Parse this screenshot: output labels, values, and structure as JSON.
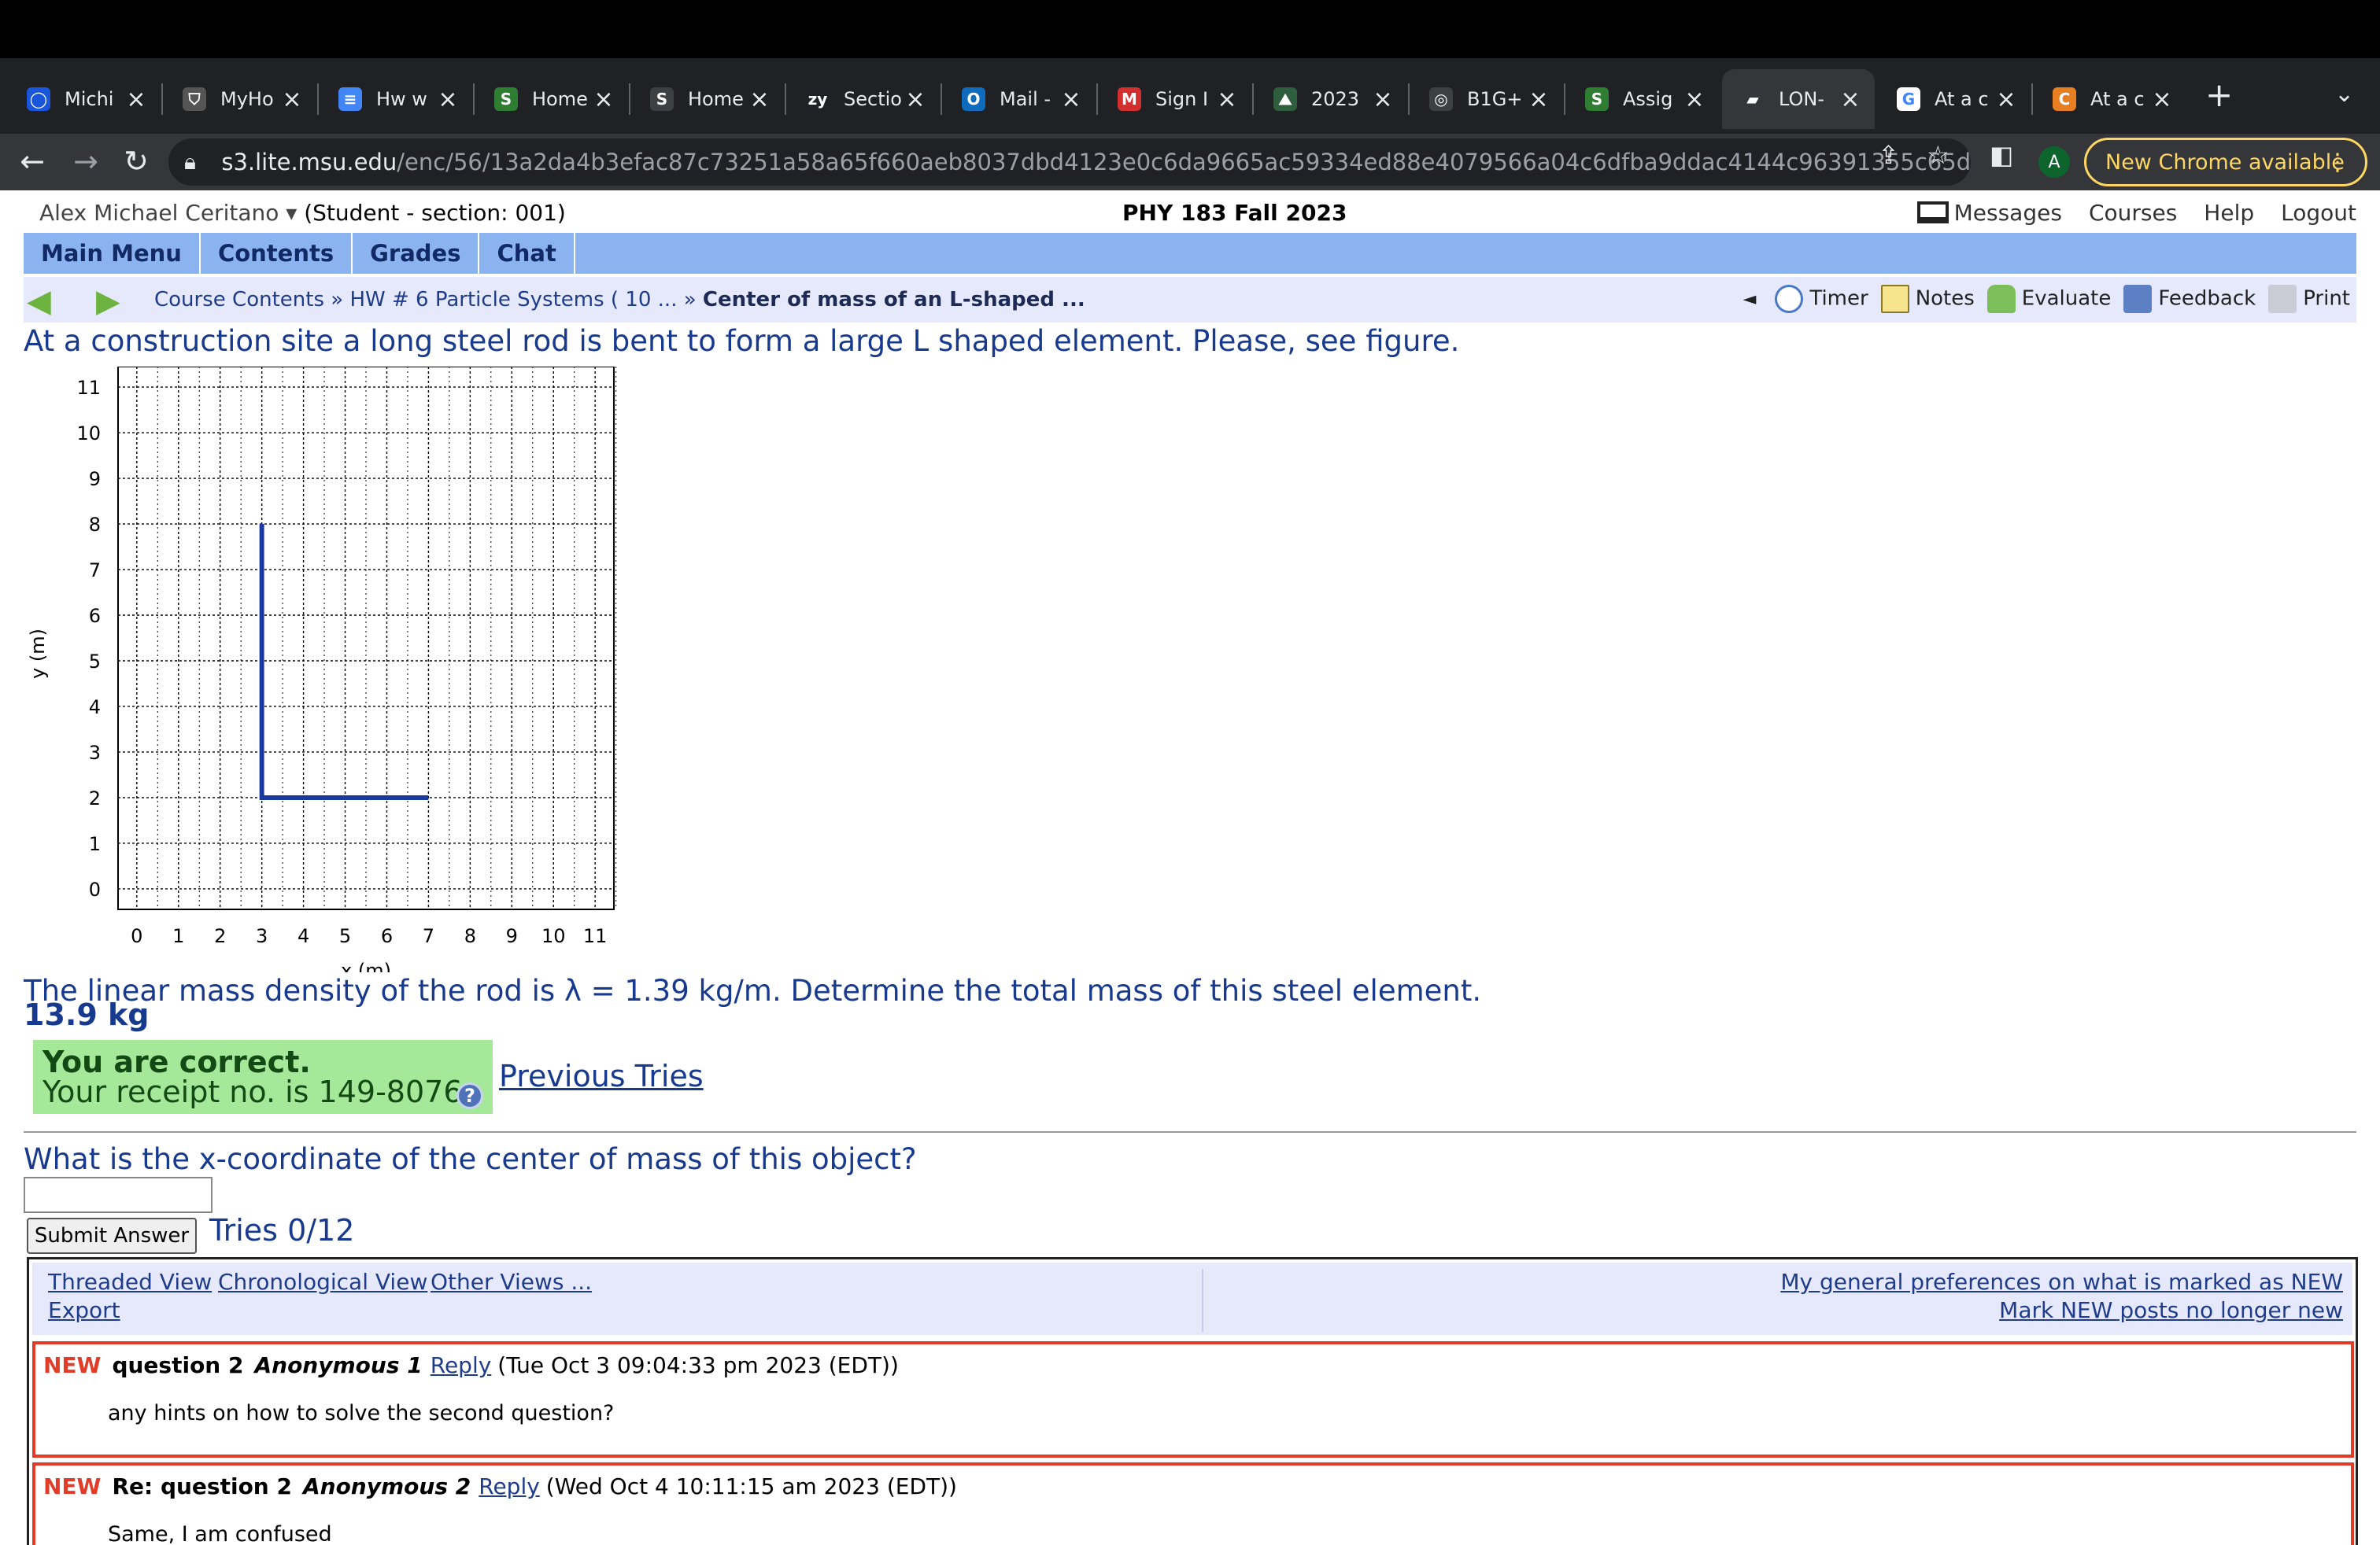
{
  "browser": {
    "tabs": [
      {
        "label": "Michi",
        "color": "#1a56db",
        "glyph": "◯"
      },
      {
        "label": "MyHo",
        "color": "#555555",
        "glyph": "⛉"
      },
      {
        "label": "Hw w",
        "color": "#4285f4",
        "glyph": "≡"
      },
      {
        "label": "Home",
        "color": "#2e7d32",
        "glyph": "S"
      },
      {
        "label": "Home",
        "color": "#3c4043",
        "glyph": "S"
      },
      {
        "label": "Sectio",
        "color": "#202124",
        "glyph": "zy"
      },
      {
        "label": "Mail -",
        "color": "#0f6cbd",
        "glyph": "O"
      },
      {
        "label": "Sign I",
        "color": "#d32f2f",
        "glyph": "M"
      },
      {
        "label": "2023",
        "color": "#2e5e3e",
        "glyph": "⛰"
      },
      {
        "label": "B1G+",
        "color": "#3c4043",
        "glyph": "◎"
      },
      {
        "label": "Assig",
        "color": "#2e7d32",
        "glyph": "S"
      },
      {
        "label": "LON-",
        "color": "#35363a",
        "glyph": "▰"
      },
      {
        "label": "At a c",
        "color": "#ffffff",
        "glyph": "G"
      },
      {
        "label": "At a c",
        "color": "#e67e22",
        "glyph": "C"
      }
    ],
    "url_host": "s3.lite.msu.edu",
    "url_path": "/enc/56/13a2da4b3efac87c73251a58a65f660aeb8037dbd4123e0c6da9665ac59334ed88e4079566a04c6dfba9ddac4144c96391355c65d...",
    "profile_initial": "A",
    "update_label": "New Chrome available"
  },
  "header": {
    "user": "Alex Michael Ceritano ▾",
    "role": "(Student  - section: 001)",
    "course": "PHY 183 Fall 2023",
    "links": [
      "Messages",
      "Courses",
      "Help",
      "Logout"
    ]
  },
  "main_menu": [
    "Main Menu",
    "Contents",
    "Grades",
    "Chat"
  ],
  "breadcrumb": {
    "item1": "Course Contents",
    "sep": " » ",
    "item2": "HW # 6 Particle Systems ( 10 ...",
    "current": "Center of mass of an L-shaped ...",
    "collapse": "◄",
    "tools": [
      "Timer",
      "Notes",
      "Evaluate",
      "Feedback",
      "Print"
    ]
  },
  "problem": {
    "intro": "At a construction site a long steel rod is bent to form a large L shaped element. Please, see figure.",
    "question1": "The linear mass density of the rod is λ = 1.39 kg/m. Determine the total mass of this steel element.",
    "answer1": "13.9 kg",
    "correct_line": "You are correct.",
    "receipt_line": "Your receipt no. is 149-8076",
    "help_glyph": "?",
    "previous_tries": "Previous Tries",
    "question2": "What is the x-coordinate of the center of mass of this object?",
    "answer2_value": "",
    "submit_label": "Submit Answer",
    "tries": "Tries 0/12"
  },
  "chart_data": {
    "type": "line",
    "xlabel": "x (m)",
    "ylabel": "y (m)",
    "xlim": [
      0,
      11
    ],
    "ylim": [
      0,
      11
    ],
    "xticks": [
      "0",
      "1",
      "2",
      "3",
      "4",
      "5",
      "6",
      "7",
      "8",
      "9",
      "10",
      "11"
    ],
    "yticks": [
      "0",
      "1",
      "2",
      "3",
      "4",
      "5",
      "6",
      "7",
      "8",
      "9",
      "10",
      "11"
    ],
    "grid": true,
    "series": [
      {
        "x": [
          3,
          3,
          7
        ],
        "y": [
          8,
          2,
          2
        ],
        "color": "#1a3aa0"
      }
    ]
  },
  "discussion": {
    "threaded": "Threaded View",
    "chronological": "Chronological View",
    "other": "Other Views ...",
    "export": "Export",
    "prefs": "My general preferences on what is marked as NEW",
    "mark": "Mark NEW posts no longer new",
    "posts": [
      {
        "new": "NEW",
        "subject": "question 2",
        "author": "Anonymous 1",
        "reply": "Reply",
        "date": "(Tue Oct 3 09:04:33 pm 2023 (EDT))",
        "body": "any hints on how to solve the second question?"
      },
      {
        "new": "NEW",
        "subject": "Re: question 2",
        "author": "Anonymous 2",
        "reply": "Reply",
        "date": "(Wed Oct 4 10:11:15 am 2023 (EDT))",
        "body": "Same, I am confused"
      }
    ]
  }
}
